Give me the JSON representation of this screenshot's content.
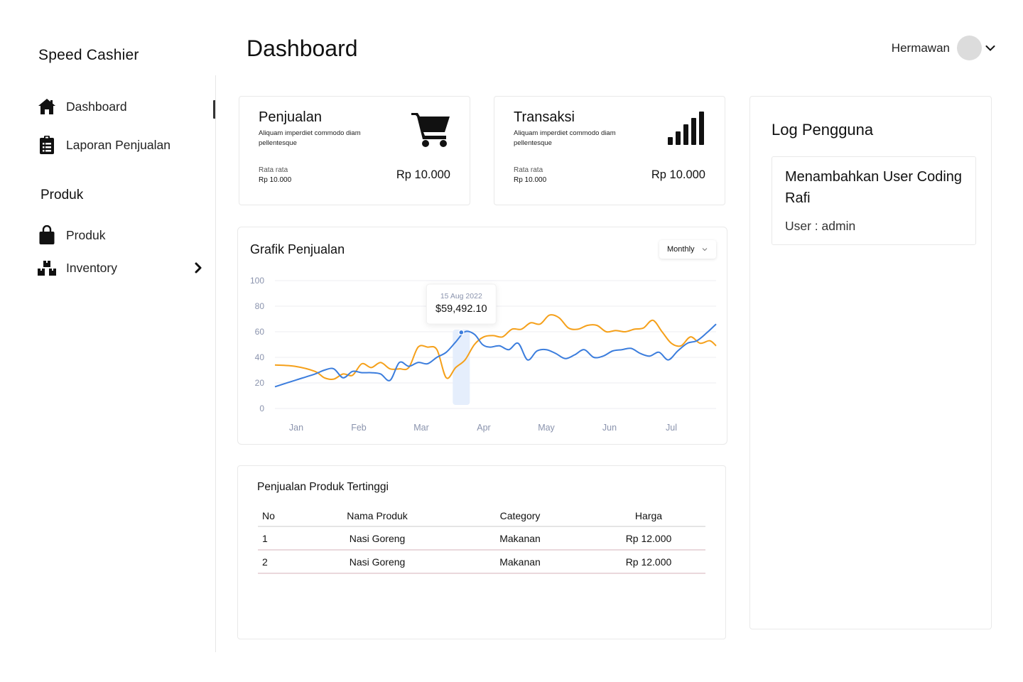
{
  "app": {
    "name": "Speed Cashier"
  },
  "sidebar": {
    "items": [
      {
        "label": "Dashboard",
        "icon": "home-icon",
        "active": true
      },
      {
        "label": "Laporan Penjualan",
        "icon": "clipboard-list-icon"
      }
    ],
    "section_title": "Produk",
    "section_items": [
      {
        "label": "Produk",
        "icon": "shopping-bag-icon"
      },
      {
        "label": "Inventory",
        "icon": "boxes-icon",
        "expand_icon": "chevron-right-icon"
      }
    ]
  },
  "header": {
    "title": "Dashboard",
    "user_name": "Hermawan"
  },
  "stats": [
    {
      "title": "Penjualan",
      "description": "Aliquam imperdiet commodo diam pellentesque",
      "avg_label": "Rata rata",
      "avg_value": "Rp 10.000",
      "value": "Rp 10.000",
      "icon": "cart-icon"
    },
    {
      "title": "Transaksi",
      "description": "Aliquam imperdiet commodo diam pellentesque",
      "avg_label": "Rata rata",
      "avg_value": "Rp 10.000",
      "value": "Rp 10.000",
      "icon": "signal-bars-icon"
    }
  ],
  "chart": {
    "title": "Grafik Penjualan",
    "period": "Monthly",
    "tooltip": {
      "date": "15 Aug 2022",
      "value": "$59,492.10"
    }
  },
  "chart_data": {
    "type": "line",
    "title": "Grafik Penjualan",
    "categories": [
      "Jan",
      "Feb",
      "Mar",
      "Apr",
      "May",
      "Jun",
      "Jul"
    ],
    "ylim": [
      0,
      100
    ],
    "yticks": [
      0,
      20,
      40,
      60,
      80,
      100
    ],
    "grid": true,
    "colors": {
      "orange": "#f5a01a",
      "blue": "#3b7ddd"
    },
    "series": [
      {
        "color": "#f5a01a",
        "x": [
          0,
          0.15,
          0.3,
          0.45,
          0.6,
          0.75,
          0.9,
          1.05,
          1.2,
          1.35,
          1.5,
          1.65,
          1.8,
          1.95,
          2.1,
          2.25,
          2.4,
          2.55,
          2.7,
          2.85,
          3.0,
          3.15,
          3.3,
          3.45,
          3.6,
          3.75,
          3.9,
          4.05,
          4.2,
          4.35,
          4.5,
          4.65,
          4.8,
          4.95,
          5.1,
          5.25,
          5.4,
          5.55,
          5.7,
          5.85,
          6.0,
          6.15,
          6.3,
          6.45,
          6.6,
          6.7
        ],
        "y": [
          34,
          33,
          29,
          24,
          23,
          27,
          26,
          35,
          32,
          36,
          31,
          31,
          32,
          48,
          48,
          46,
          24,
          32,
          38,
          50,
          56,
          57,
          56,
          62,
          62,
          67,
          66,
          73,
          71,
          63,
          62,
          65,
          65,
          60,
          61,
          60,
          62,
          63,
          69,
          60,
          51,
          49,
          56,
          51,
          53,
          49
        ]
      },
      {
        "color": "#3b7ddd",
        "x": [
          0,
          0.15,
          0.3,
          0.45,
          0.6,
          0.75,
          0.9,
          1.05,
          1.2,
          1.35,
          1.5,
          1.65,
          1.8,
          1.95,
          2.1,
          2.25,
          2.4,
          2.55,
          2.7,
          2.85,
          2.98,
          3.1,
          3.25,
          3.4,
          3.55,
          3.7,
          3.85,
          4.0,
          4.15,
          4.3,
          4.45,
          4.6,
          4.75,
          4.9,
          5.05,
          5.2,
          5.35,
          5.5,
          5.65,
          5.8,
          5.95,
          6.1,
          6.25,
          6.4,
          6.55,
          6.7
        ],
        "y": [
          17,
          22,
          27,
          30,
          31,
          24,
          29,
          28,
          28,
          27,
          22,
          36,
          33,
          36,
          35,
          40,
          44,
          52,
          60,
          58,
          50,
          48,
          49,
          46,
          51,
          38,
          45,
          46,
          43,
          39,
          42,
          46,
          40,
          41,
          45,
          46,
          47,
          43,
          41,
          44,
          38,
          45,
          51,
          53,
          59,
          66
        ]
      }
    ],
    "tooltip_point": {
      "x": 2.64,
      "y": 59.49
    }
  },
  "top_products": {
    "title": "Penjualan Produk Tertinggi",
    "columns": [
      "No",
      "Nama Produk",
      "Category",
      "Harga"
    ],
    "rows": [
      [
        "1",
        "Nasi Goreng",
        "Makanan",
        "Rp 12.000"
      ],
      [
        "2",
        "Nasi Goreng",
        "Makanan",
        "Rp 12.000"
      ]
    ]
  },
  "log": {
    "title": "Log Pengguna",
    "entries": [
      {
        "message": "Menambahkan User Coding Rafi",
        "user": "User : admin"
      }
    ]
  }
}
